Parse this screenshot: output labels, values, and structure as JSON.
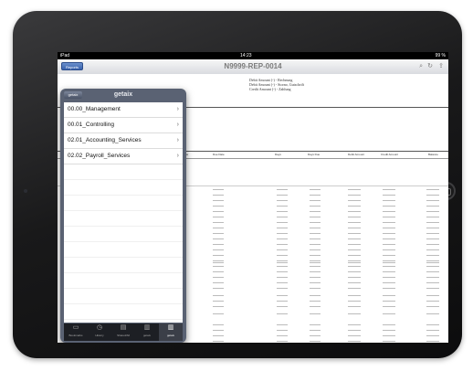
{
  "status": {
    "carrier": "iPad",
    "time": "14:23",
    "battery": "99 %"
  },
  "nav": {
    "back_label": "Reports",
    "title": "N9999-REP-0014",
    "icons": [
      "search-icon",
      "refresh-icon",
      "share-icon"
    ]
  },
  "legend": [
    "Debit Amount (-) - Rechnung",
    "Debit Amount (-) - Storno, Gutschrift",
    "Credit Amount (-) - Zahlung"
  ],
  "columns": [
    "Posting Date",
    "Due Date",
    "Days",
    "Days Due",
    "Debit Amount",
    "Credit Amount",
    "Balance"
  ],
  "popover": {
    "back_label": "getaix",
    "title": "getaix",
    "items": [
      "00.00_Management",
      "00.01_Controlling",
      "02.01_Accounting_Services",
      "02.02_Payroll_Services"
    ]
  },
  "tabs": [
    "Bookmarks",
    "History",
    "Shared/All",
    "getaix",
    "getaix"
  ]
}
